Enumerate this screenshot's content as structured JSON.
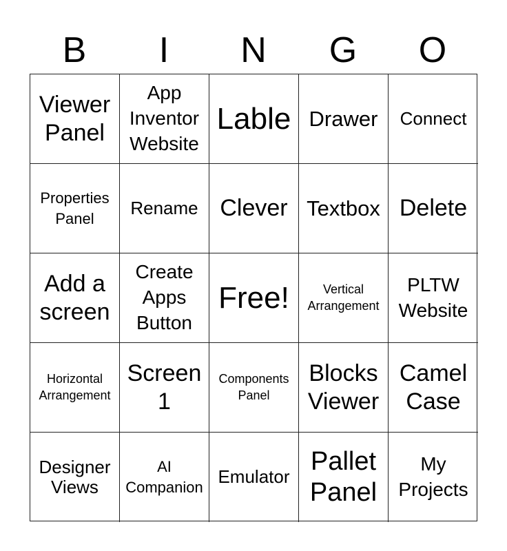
{
  "header": {
    "letters": [
      "B",
      "I",
      "N",
      "G",
      "O"
    ]
  },
  "board": {
    "cells": [
      [
        "Viewer Panel",
        "App Inventor Website",
        "Lable",
        "Drawer",
        "Connect"
      ],
      [
        "Properties Panel",
        "Rename",
        "Clever",
        "Textbox",
        "Delete"
      ],
      [
        "Add a screen",
        "Create Apps Button",
        "Free!",
        "Vertical Arrangement",
        "PLTW Website"
      ],
      [
        "Horizontal Arrangement",
        "Screen 1",
        "Components Panel",
        "Blocks Viewer",
        "Camel Case"
      ],
      [
        "Designer Views",
        "AI Companion",
        "Emulator",
        "Pallet Panel",
        "My Projects"
      ]
    ]
  }
}
